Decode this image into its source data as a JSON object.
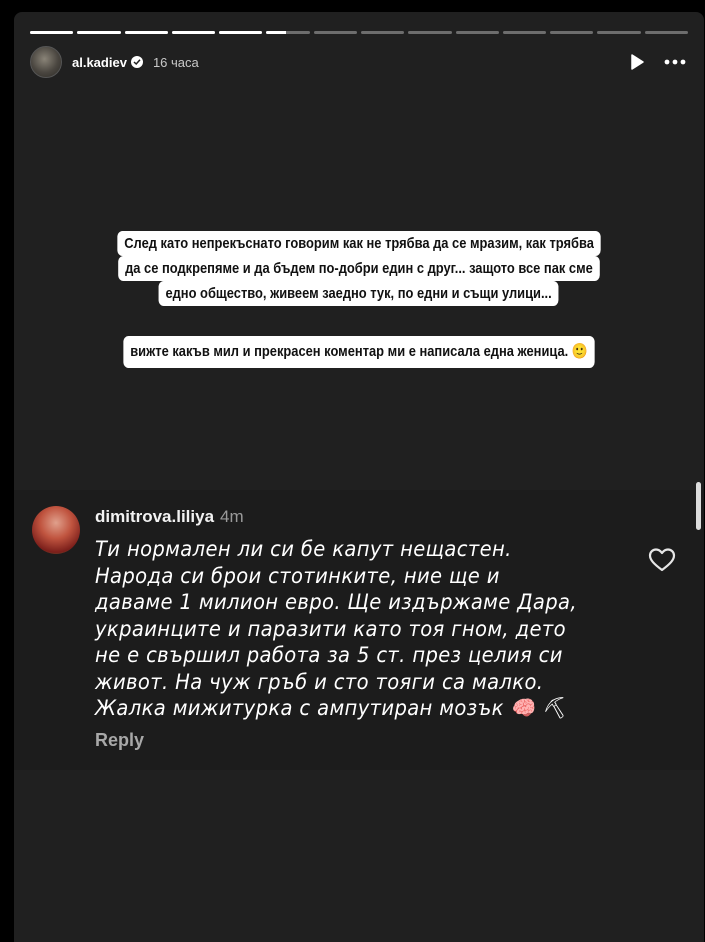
{
  "story": {
    "progress_segments": 14,
    "progress_completed_segments": 5,
    "progress_current_fraction": 0.45,
    "header": {
      "username": "al.kadiev",
      "verified": true,
      "time": "16 часа",
      "play_icon": "play-icon",
      "more_icon": "more-horizontal-icon"
    },
    "caption_lines_1": [
      "След като непрекъснато говорим как не трябва да се мразим, как трябва",
      "да се подкрепяме и да бъдем по-добри един с друг... защото все пак сме",
      "едно общество, живеем заедно тук, по едни и същи улици..."
    ],
    "caption_line_2": "вижте какъв мил и прекрасен коментар ми е написала една женица. 🙂"
  },
  "comment": {
    "username": "dimitrova.liliya",
    "time": "4m",
    "text": "Ти нормален ли си бе капут нещастен. Народа си брои стотинките, ние ще и даваме 1 милион евро. Ще издържаме Дара, украинците и паразити като тоя гном, дето не е свършил работа за 5 ст. през целия си живот. На чуж гръб и сто тояги са малко. Жалка мижитурка с ампутиран мозък 🧠 ⛏",
    "reply_label": "Reply",
    "like_icon": "heart-outline-icon"
  },
  "colors": {
    "background": "#000000",
    "story_background": "#202020",
    "comment_background": "#1c1c1c",
    "caption_background": "#ffffff"
  }
}
